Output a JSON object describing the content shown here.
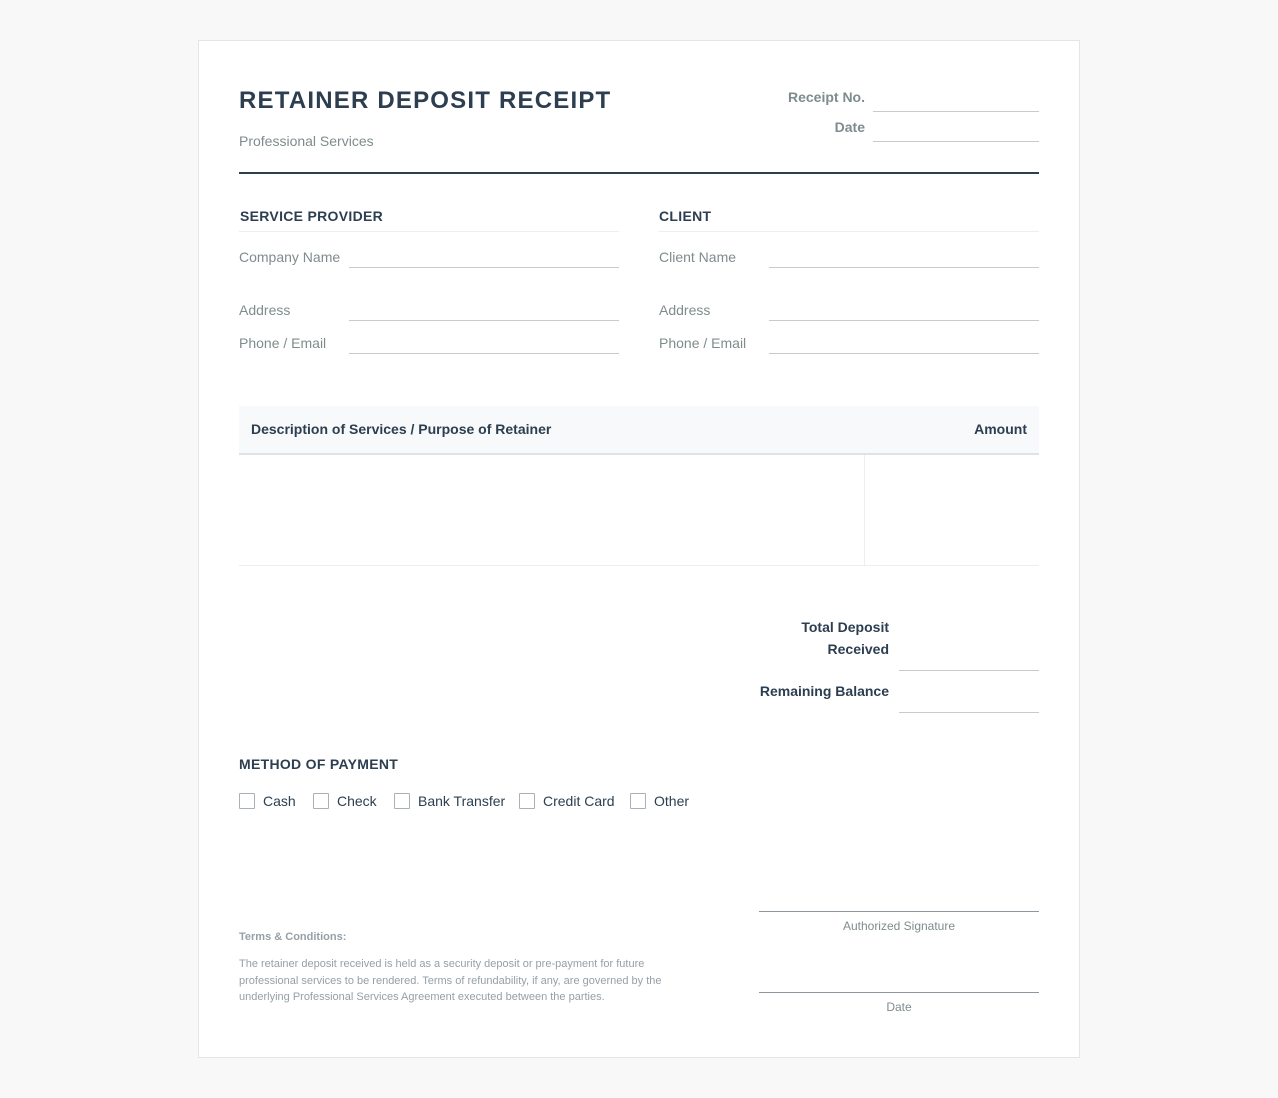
{
  "header": {
    "title": "RETAINER DEPOSIT RECEIPT",
    "subtitle": "Professional Services",
    "receipt_no_label": "Receipt No.",
    "date_label": "Date"
  },
  "provider": {
    "heading": "SERVICE PROVIDER",
    "company_label": "Company Name",
    "address_label": "Address",
    "contact_label": "Phone / Email"
  },
  "client": {
    "heading": "CLIENT",
    "name_label": "Client Name",
    "address_label": "Address",
    "contact_label": "Phone / Email"
  },
  "table": {
    "columns": [
      "Description of Services / Purpose of Retainer",
      "Amount"
    ]
  },
  "totals": {
    "deposit_label_line1": "Total Deposit",
    "deposit_label_line2": "Received",
    "balance_label": "Remaining Balance"
  },
  "payment": {
    "heading": "METHOD OF PAYMENT",
    "options": [
      "Cash",
      "Check",
      "Bank Transfer",
      "Credit Card",
      "Other"
    ]
  },
  "terms": {
    "heading": "Terms & Conditions:",
    "text": "The retainer deposit received is held as a security deposit or pre-payment for future professional services to be rendered. Terms of refundability, if any, are governed by the underlying Professional Services Agreement executed between the parties."
  },
  "signature": {
    "authorized_caption": "Authorized Signature",
    "date_caption": "Date"
  },
  "colors": {
    "ink": "#2c3e50",
    "muted": "#7f8c8d",
    "page_background": "#f8f8f8"
  }
}
